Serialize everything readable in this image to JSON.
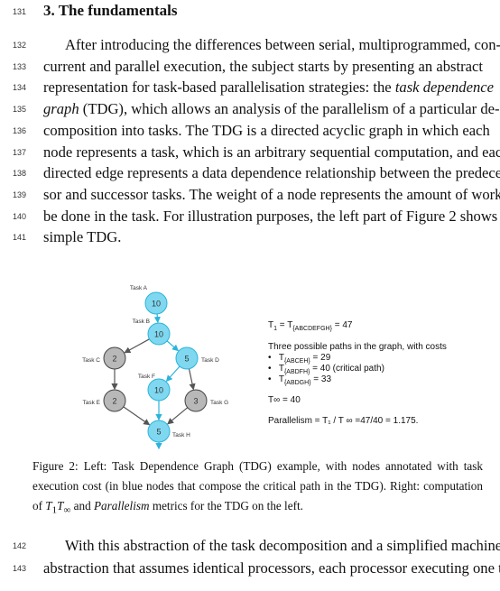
{
  "section": {
    "number": "131",
    "title": "3.  The fundamentals"
  },
  "paragraph1": {
    "lines": [
      {
        "n": "132",
        "text": "After introducing the differences between serial, multiprogrammed, con-"
      },
      {
        "n": "133",
        "text": "current and parallel execution, the subject starts by presenting an abstract"
      },
      {
        "n": "134",
        "pre": "representation for task-based parallelisation strategies:  the ",
        "em": "task dependence"
      },
      {
        "n": "135",
        "em": "graph",
        "post": " (TDG), which allows an analysis of the parallelism of a particular de-"
      },
      {
        "n": "136",
        "text": "composition into tasks.  The TDG is a directed acyclic graph in which each"
      },
      {
        "n": "137",
        "text": "node represents a task, which is an arbitrary sequential computation, and each"
      },
      {
        "n": "138",
        "text": "directed edge represents a data dependence relationship between the predeces-"
      },
      {
        "n": "139",
        "text": "sor and successor tasks. The weight of a node represents the amount of work to"
      },
      {
        "n": "140",
        "text": "be done in the task. For illustration purposes, the left part of Figure 2 shows a"
      },
      {
        "n": "141",
        "text": "simple TDG."
      }
    ]
  },
  "figure": {
    "colors": {
      "critical": "#7fd8f0",
      "critical_stroke": "#2bb3dc",
      "other": "#b8b8b8",
      "other_stroke": "#444444",
      "edge_critical": "#2bb3dc",
      "edge_other": "#555555"
    },
    "nodes": [
      {
        "id": "A",
        "label": "Task A",
        "cost": "10",
        "critical": true
      },
      {
        "id": "B",
        "label": "Task B",
        "cost": "10",
        "critical": true
      },
      {
        "id": "C",
        "label": "Task C",
        "cost": "2",
        "critical": false
      },
      {
        "id": "D",
        "label": "Task D",
        "cost": "5",
        "critical": true
      },
      {
        "id": "F",
        "label": "Task F",
        "cost": "10",
        "critical": true
      },
      {
        "id": "E",
        "label": "Task E",
        "cost": "2",
        "critical": false
      },
      {
        "id": "G",
        "label": "Task G",
        "cost": "3",
        "critical": false
      },
      {
        "id": "H",
        "label": "Task H",
        "cost": "5",
        "critical": true
      }
    ],
    "edges": [
      [
        "A",
        "B"
      ],
      [
        "B",
        "C"
      ],
      [
        "B",
        "D"
      ],
      [
        "C",
        "E"
      ],
      [
        "D",
        "F"
      ],
      [
        "D",
        "G"
      ],
      [
        "E",
        "H"
      ],
      [
        "F",
        "H"
      ],
      [
        "G",
        "H"
      ]
    ],
    "right": {
      "t1": "T",
      "t1_sub": "1",
      "t1_eq": " = T",
      "t1_path": "{ABCDEFGH}",
      "t1_val": " = 47",
      "paths_intro": "Three possible paths in the graph, with costs",
      "paths": [
        {
          "path": "{ABCEH}",
          "value": " = 29"
        },
        {
          "path": "{ABDFH}",
          "value": " = 40 (critical path)"
        },
        {
          "path": "{ABDGH}",
          "value": " = 33"
        }
      ],
      "tinf": "T∞ = 40",
      "parallelism": "Parallelism = T₁ / T ∞ =47/40 = 1.175."
    },
    "caption": [
      "Figure 2:  Left:  Task Dependence Graph (TDG) example, with nodes annotated with task",
      "execution cost (in blue nodes that compose the critical path in the TDG). Right: computation"
    ],
    "caption_last": {
      "pre": "of ",
      "t1": "T",
      "s1": "1",
      ", ": ", ",
      "tinf": "T",
      "sinf": "∞",
      "mid": " and ",
      "em": "Parallelism",
      "post": " metrics for the TDG on the left."
    }
  },
  "paragraph2": {
    "lines": [
      {
        "n": "142",
        "text": "With this abstraction of the task decomposition and a simplified machine"
      },
      {
        "n": "143",
        "text": "abstraction that assumes identical processors, each processor executing one task"
      }
    ]
  }
}
